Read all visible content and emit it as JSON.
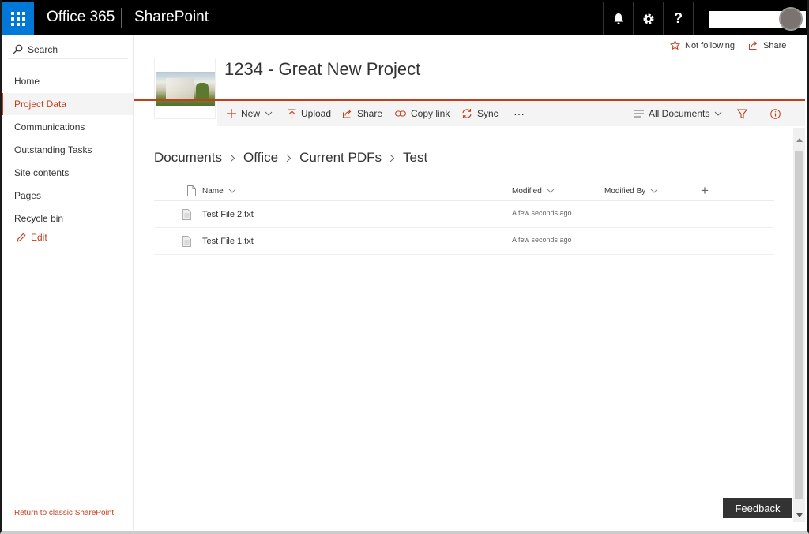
{
  "suitebar": {
    "app_name": "Office 365",
    "brand": "SharePoint",
    "help_label": "?"
  },
  "leftnav": {
    "search_label": "Search",
    "items": [
      {
        "label": "Home",
        "active": false
      },
      {
        "label": "Project Data",
        "active": true
      },
      {
        "label": "Communications",
        "active": false
      },
      {
        "label": "Outstanding Tasks",
        "active": false
      },
      {
        "label": "Site contents",
        "active": false
      },
      {
        "label": "Pages",
        "active": false
      },
      {
        "label": "Recycle bin",
        "active": false
      }
    ],
    "edit_label": "Edit",
    "return_label": "Return to classic SharePoint"
  },
  "header": {
    "follow_label": "Not following",
    "share_label": "Share",
    "site_title": "1234 - Great New Project"
  },
  "commands": {
    "new": "New",
    "upload": "Upload",
    "share": "Share",
    "copy_link": "Copy link",
    "sync": "Sync",
    "more": "···",
    "view": "All Documents"
  },
  "breadcrumb": [
    "Documents",
    "Office",
    "Current PDFs",
    "Test"
  ],
  "table": {
    "columns": {
      "name": "Name",
      "modified": "Modified",
      "modified_by": "Modified By",
      "add": "+"
    },
    "rows": [
      {
        "name": "Test File 2.txt",
        "modified": "A few seconds ago"
      },
      {
        "name": "Test File 1.txt",
        "modified": "A few seconds ago"
      }
    ]
  },
  "feedback_label": "Feedback",
  "colors": {
    "accent": "#c43e1c",
    "waffle": "#0078d7",
    "suitebar": "#000000"
  }
}
